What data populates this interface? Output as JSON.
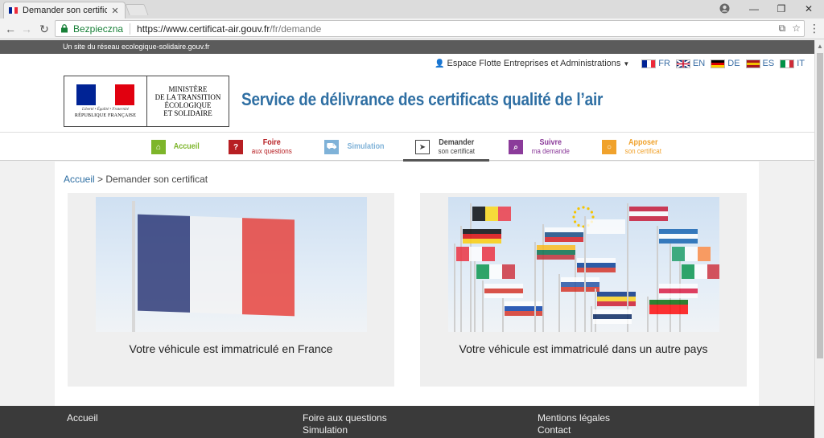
{
  "browser": {
    "tab_title": "Demander son certificat",
    "secure_label": "Bezpieczna",
    "url_host": "https://www.certificat-air.gouv.fr",
    "url_path": "/fr/demande",
    "window_controls": {
      "minimize": "—",
      "restore": "❐",
      "close": "✕"
    }
  },
  "page": {
    "network_banner": "Un site du réseau ecologique-solidaire.gouv.fr",
    "fleet_space": "Espace Flotte Entreprises et Administrations",
    "languages": [
      {
        "code": "FR",
        "colors": [
          "#002395",
          "#ffffff",
          "#ed2939"
        ],
        "dir": "v"
      },
      {
        "code": "EN",
        "colors": [
          "#012169",
          "#c8102e",
          "#012169"
        ],
        "dir": "uk"
      },
      {
        "code": "DE",
        "colors": [
          "#000000",
          "#dd0000",
          "#ffce00"
        ],
        "dir": "h"
      },
      {
        "code": "ES",
        "colors": [
          "#aa151b",
          "#f1bf00",
          "#aa151b"
        ],
        "dir": "h"
      },
      {
        "code": "IT",
        "colors": [
          "#009246",
          "#ffffff",
          "#ce2b37"
        ],
        "dir": "v"
      }
    ],
    "logo": {
      "devise": "Liberté • Égalité • Fraternité",
      "republique": "RÉPUBLIQUE FRANÇAISE",
      "ministere": [
        "MINISTÈRE",
        "DE LA TRANSITION",
        "ÉCOLOGIQUE",
        "ET SOLIDAIRE"
      ]
    },
    "site_title": "Service de délivrance des certificats qualité de l’air",
    "nav": {
      "accueil": {
        "label": "Accueil",
        "color": "#7db52a"
      },
      "faq": {
        "label": "Foire",
        "sub": "aux questions",
        "color": "#b71f23"
      },
      "simulation": {
        "label": "Simulation",
        "color": "#7fb2d8"
      },
      "demander": {
        "label": "Demander",
        "sub": "son certificat",
        "color": "#444444"
      },
      "suivre": {
        "label": "Suivre",
        "sub": "ma demande",
        "color": "#8b3b9a"
      },
      "apposer": {
        "label": "Apposer",
        "sub": "son certificat",
        "color": "#f0a22c"
      }
    },
    "breadcrumb": {
      "home": "Accueil",
      "sep": " > ",
      "current": "Demander son certificat"
    },
    "cards": {
      "france": "Votre véhicule est immatriculé en France",
      "autre": "Votre véhicule est immatriculé dans un autre pays"
    },
    "footer": {
      "accueil": "Accueil",
      "faq": "Foire aux questions",
      "simulation": "Simulation",
      "mentions": "Mentions légales",
      "contact": "Contact"
    }
  }
}
